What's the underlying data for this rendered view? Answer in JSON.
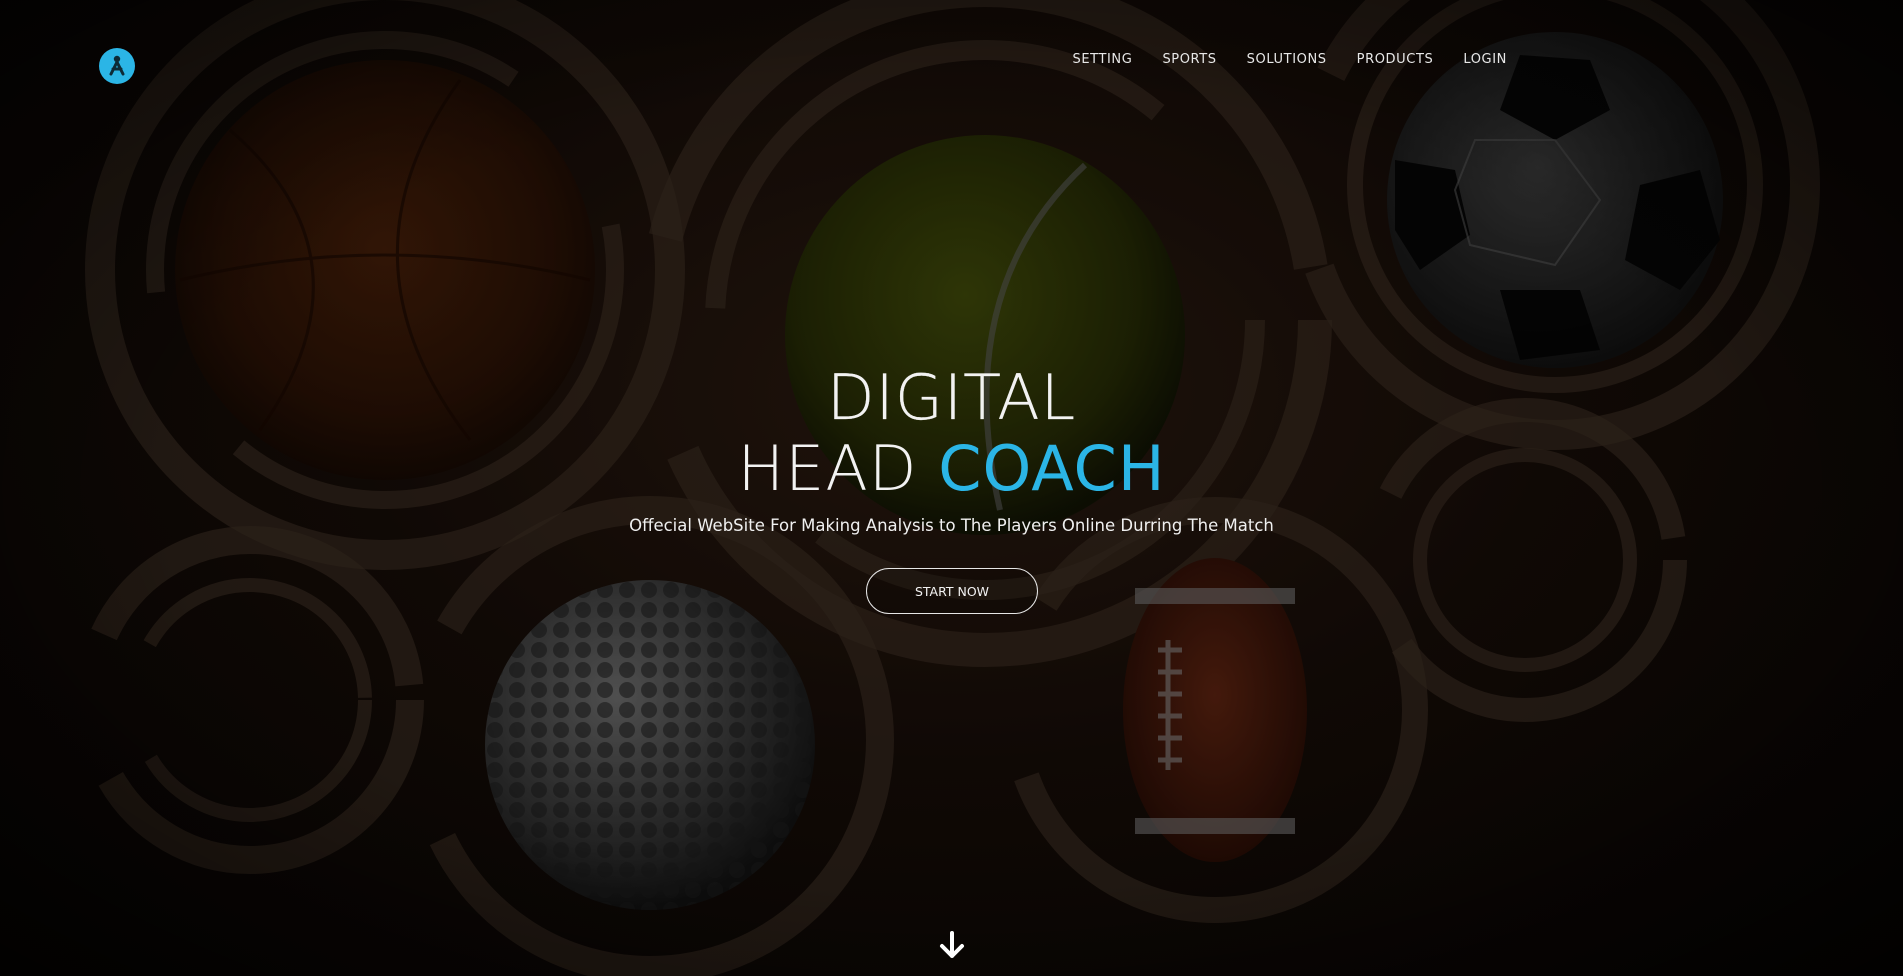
{
  "header": {
    "logo_icon": "logo-icon",
    "nav": [
      {
        "label": "SETTING"
      },
      {
        "label": "SPORTS"
      },
      {
        "label": "SOLUTIONS"
      },
      {
        "label": "PRODUCTS"
      },
      {
        "label": "LOGIN"
      }
    ]
  },
  "hero": {
    "title_line1": "DIGITAL",
    "title_line2_part1": "HEAD",
    "title_line2_part2": "COACH",
    "subtitle": "Offecial WebSite For Making Analysis to The Players Online Durring The Match",
    "cta_label": "START NOW",
    "scroll_icon": "arrow-down-icon"
  },
  "colors": {
    "accent": "#2bb5e6",
    "background": "#0b0705",
    "text": "#f2f2f2"
  }
}
